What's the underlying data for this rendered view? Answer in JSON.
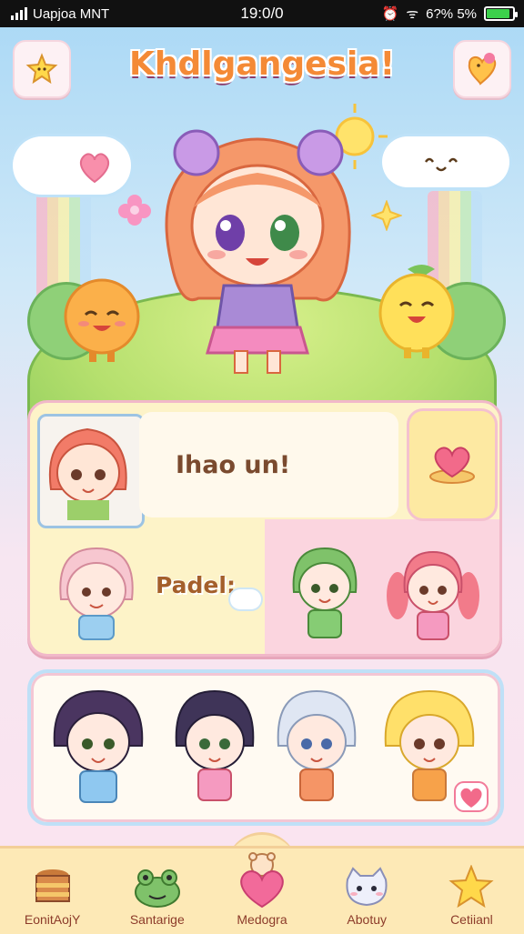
{
  "status_bar": {
    "carrier": "Uapjoa MNT",
    "time": "19:0/0",
    "battery_text": "6?% 5%",
    "battery_level": 0.9
  },
  "header": {
    "title": "Khdlgangesia!",
    "left_icon": "sparkle-star-icon",
    "right_icon": "heart-bird-icon"
  },
  "card": {
    "message": "Ihao un!",
    "label": "Padel:",
    "action_icon": "heart-icon"
  },
  "tabs": [
    {
      "label": "EonitAojY",
      "icon": "cake-icon"
    },
    {
      "label": "Santarige",
      "icon": "frog-icon"
    },
    {
      "label": "Medogra",
      "icon": "heart-bear-icon"
    },
    {
      "label": "Abotuy",
      "icon": "cat-face-icon"
    },
    {
      "label": "Cetiianl",
      "icon": "star-icon"
    }
  ],
  "colors": {
    "title": "#f48a36",
    "accent_pink": "#f4b6c8",
    "tabbar": "#fde9b6"
  }
}
